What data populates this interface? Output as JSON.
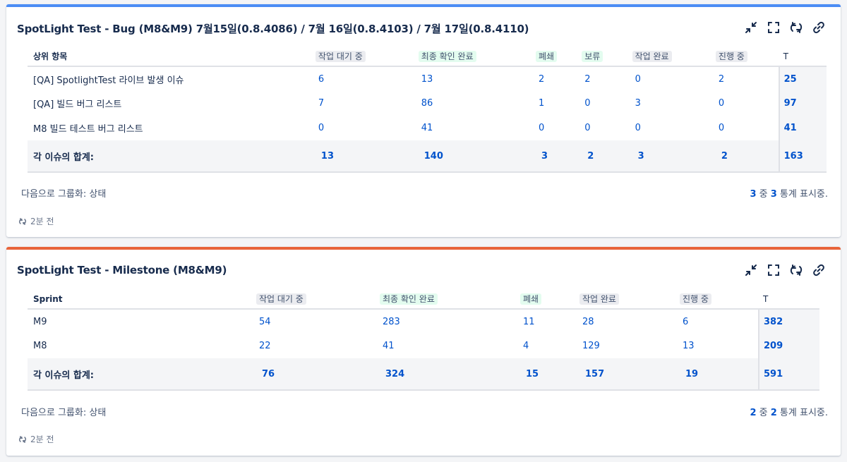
{
  "gadgets": [
    {
      "title": "SpotLight Test - Bug (M8&M9) 7월15일(0.8.4086) / 7월 16일(0.8.4103) / 7월 17일(0.8.4110)",
      "accent": "#4c8df5",
      "first_header": "상위 항목",
      "columns": [
        "작업 대기 중",
        "최종 확인 완료",
        "폐쇄",
        "보류",
        "작업 완료",
        "진행 중"
      ],
      "column_lozenge": [
        "gray",
        "green",
        "green",
        "green",
        "gray",
        "gray"
      ],
      "total_header": "T",
      "rows": [
        {
          "label": "[QA] SpotlightTest 라이브 발생 이슈",
          "values": [
            "6",
            "13",
            "2",
            "2",
            "0",
            "2"
          ],
          "total": "25"
        },
        {
          "label": "[QA] 빌드 버그 리스트",
          "values": [
            "7",
            "86",
            "1",
            "0",
            "3",
            "0"
          ],
          "total": "97"
        },
        {
          "label": "M8 빌드 테스트 버그 리스트",
          "values": [
            "0",
            "41",
            "0",
            "0",
            "0",
            "0"
          ],
          "total": "41"
        }
      ],
      "summary": {
        "label": "각 이슈의 합계:",
        "values": [
          "13",
          "140",
          "3",
          "2",
          "3",
          "2"
        ],
        "total": "163"
      },
      "group_by": "다음으로 그룹화: 상태",
      "showing": {
        "a": "3",
        "mid": " 중 ",
        "b": "3",
        "suffix": " 통계 표시중."
      },
      "refreshed": "2분 전"
    },
    {
      "title": "SpotLight Test - Milestone (M8&M9)",
      "accent": "#e8643a",
      "first_header": "Sprint",
      "columns": [
        "작업 대기 중",
        "최종 확인 완료",
        "폐쇄",
        "작업 완료",
        "진행 중"
      ],
      "column_lozenge": [
        "gray",
        "green",
        "green",
        "gray",
        "gray"
      ],
      "total_header": "T",
      "rows": [
        {
          "label": "M9",
          "values": [
            "54",
            "283",
            "11",
            "28",
            "6"
          ],
          "total": "382"
        },
        {
          "label": "M8",
          "values": [
            "22",
            "41",
            "4",
            "129",
            "13"
          ],
          "total": "209"
        }
      ],
      "summary": {
        "label": "각 이슈의 합계:",
        "values": [
          "76",
          "324",
          "15",
          "157",
          "19"
        ],
        "total": "591"
      },
      "group_by": "다음으로 그룹화: 상태",
      "showing": {
        "a": "2",
        "mid": " 중 ",
        "b": "2",
        "suffix": " 통계 표시중."
      },
      "refreshed": "2분 전"
    }
  ],
  "icons": [
    "minimize-icon",
    "fullscreen-icon",
    "refresh-icon",
    "link-icon"
  ]
}
